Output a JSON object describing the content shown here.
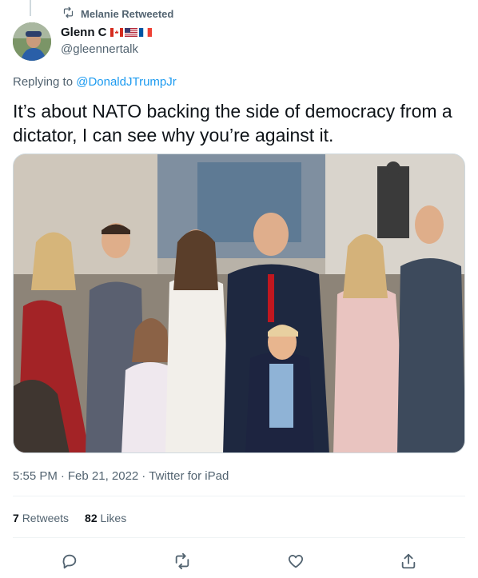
{
  "context": {
    "label": "Melanie Retweeted"
  },
  "author": {
    "name": "Glenn C",
    "handle": "@gleennertalk"
  },
  "reply": {
    "prefix": "Replying to",
    "target": "@DonaldJTrumpJr"
  },
  "tweet": {
    "text": "It’s about NATO backing the side of democracy from a dictator, I can see why you’re against it."
  },
  "meta": {
    "time": "5:55 PM",
    "sep1": "·",
    "date": "Feb 21, 2022",
    "sep2": "·",
    "source": "Twitter for iPad"
  },
  "stats": {
    "retweets_count": "7",
    "retweets_label": "Retweets",
    "likes_count": "82",
    "likes_label": "Likes"
  },
  "icons": {
    "retweet": "retweet-icon",
    "reply": "reply-icon",
    "like": "heart-icon",
    "share": "share-icon"
  },
  "colors": {
    "accent": "#1d9bf0",
    "secondary_text": "#536471"
  }
}
